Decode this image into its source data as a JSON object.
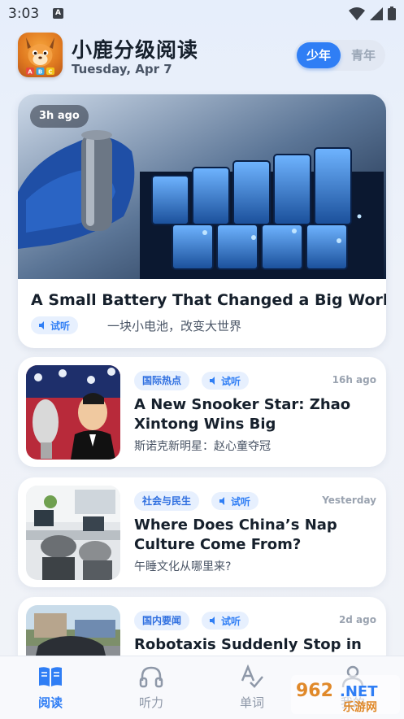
{
  "status": {
    "time": "3:03",
    "notif_letter": "A"
  },
  "header": {
    "app_name": "小鹿分级阅读",
    "date": "Tuesday, Apr 7",
    "levels": [
      "少年",
      "青年"
    ],
    "active_level": "少年"
  },
  "featured": {
    "time": "3h ago",
    "title": "A Small Battery That Changed a Big World",
    "listen": "试听",
    "subtitle": "一块小电池，改变大世界"
  },
  "articles": [
    {
      "tag": "国际热点",
      "listen": "试听",
      "time": "16h ago",
      "title": "A New Snooker Star: Zhao Xintong Wins Big",
      "subtitle": "斯诺克新明星：赵心童夺冠"
    },
    {
      "tag": "社会与民生",
      "listen": "试听",
      "time": "Yesterday",
      "title": "Where Does China’s Nap Culture Come From?",
      "subtitle": "午睡文化从哪里来?"
    },
    {
      "tag": "国内要闻",
      "listen": "试听",
      "time": "2d ago",
      "title": "Robotaxis Suddenly Stop in",
      "subtitle": ""
    }
  ],
  "nav": {
    "items": [
      "阅读",
      "听力",
      "单词",
      "我的"
    ],
    "active": "阅读"
  },
  "watermark": {
    "text": "962.NET",
    "sub": "乐游网"
  },
  "colors": {
    "accent": "#2f7ef5",
    "tag_bg": "#e7f0fe"
  }
}
